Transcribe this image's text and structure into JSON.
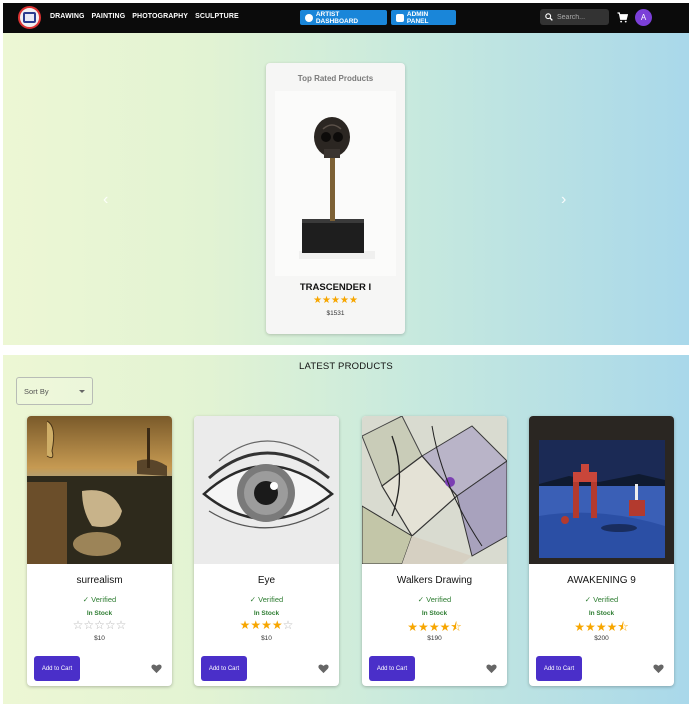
{
  "nav": {
    "links": [
      "DRAWING",
      "PAINTING",
      "PHOTOGRAPHY",
      "SCULPTURE"
    ],
    "artist_dashboard": "ARTIST DASHBOARD",
    "admin_panel": "ADMIN PANEL",
    "search_placeholder": "Search...",
    "avatar_initial": "A",
    "icons": [
      "logo-icon",
      "palette-icon",
      "shield-icon",
      "search-icon",
      "cart-icon"
    ]
  },
  "hero": {
    "card_title": "Top Rated Products",
    "product_name": "TRASCENDER I",
    "stars": "★★★★★",
    "rating": 5,
    "price": "$1531",
    "icons": [
      "chevron-left-icon",
      "chevron-right-icon"
    ]
  },
  "latest": {
    "title": "LATEST PRODUCTS",
    "sort_label": "Sort By",
    "products": [
      {
        "name": "surrealism",
        "verified": "Verified",
        "stock": "In Stock",
        "rating": 0,
        "price": "$10",
        "add_label": "Add to Cart"
      },
      {
        "name": "Eye",
        "verified": "Verified",
        "stock": "In Stock",
        "rating": 4,
        "price": "$10",
        "add_label": "Add to Cart"
      },
      {
        "name": "Walkers Drawing",
        "verified": "Verified",
        "stock": "In Stock",
        "rating": 4.5,
        "price": "$190",
        "add_label": "Add to Cart"
      },
      {
        "name": "AWAKENING 9",
        "verified": "Verified",
        "stock": "In Stock",
        "rating": 4.5,
        "price": "$200",
        "add_label": "Add to Cart"
      }
    ]
  },
  "colors": {
    "navbar": "#0b0b0b",
    "nav_button": "#1a86d9",
    "accent_purple": "#4a2fc9",
    "star": "#f7a600",
    "in_stock": "#2e7d32"
  }
}
